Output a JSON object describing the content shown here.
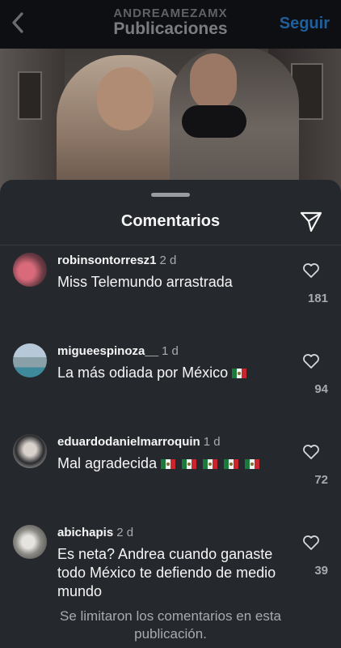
{
  "header": {
    "username": "ANDREAMEZAMX",
    "title": "Publicaciones",
    "follow_label": "Seguir"
  },
  "sheet": {
    "title": "Comentarios"
  },
  "comments": [
    {
      "user": "robinsontorresz1",
      "time": "2 d",
      "text": "Miss Telemundo arrastrada",
      "likes": "181",
      "flags": 0
    },
    {
      "user": "migueespinoza__",
      "time": "1 d",
      "text": "La más odiada por México",
      "likes": "94",
      "flags": 1
    },
    {
      "user": "eduardodanielmarroquin",
      "time": "1 d",
      "text": "Mal agradecida",
      "likes": "72",
      "flags": 5
    },
    {
      "user": "abichapis",
      "time": "2 d",
      "text": "Es neta? Andrea cuando ganaste todo México te defiendo de medio mundo",
      "likes": "39",
      "flags": 0
    }
  ],
  "footer": {
    "limited_note": "Se limitaron los comentarios en esta publicación."
  },
  "colors": {
    "sheet_bg": "#25282d",
    "follow": "#1f5f9c",
    "muted": "#a8aaae"
  },
  "icons": [
    "back-chevron-icon",
    "share-send-icon",
    "heart-outline-icon",
    "mexico-flag-icon"
  ]
}
